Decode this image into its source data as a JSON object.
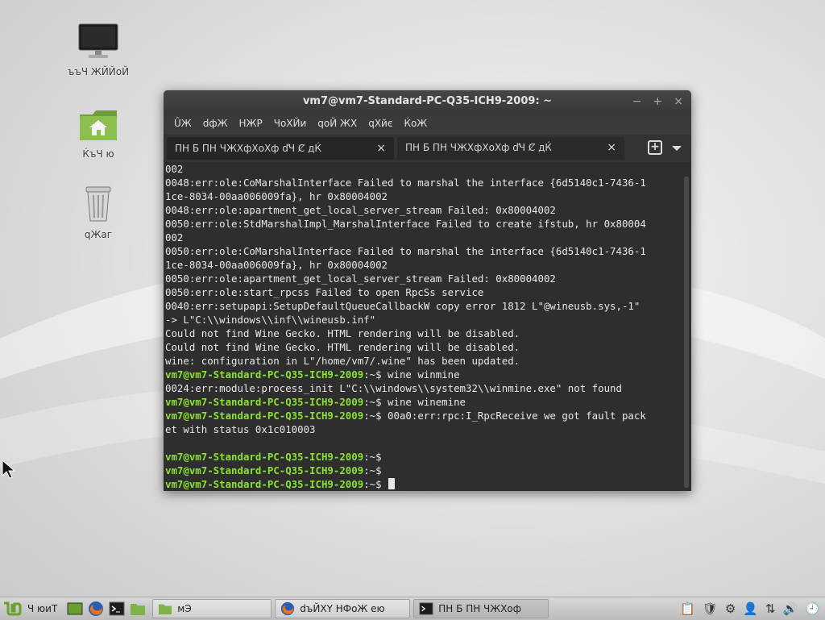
{
  "desktop": {
    "icons": [
      {
        "label": "ъъЧ ЖЙЙоЙ",
        "icon": "computer-icon"
      },
      {
        "label": "ЌъЧ ю",
        "icon": "home-folder-icon"
      },
      {
        "label": "qЖаг",
        "icon": "trash-icon"
      }
    ]
  },
  "window": {
    "title": "vm7@vm7-Standard-PC-Q35-ICH9-2009: ~",
    "controls": {
      "minimize": "−",
      "maximize": "+",
      "close": "×"
    },
    "menu": [
      "ÛЖ",
      "dфЖ",
      "НЖР",
      "ЧоХЙи",
      "qоЙ ЖХ",
      "qХйє",
      "ЌоЖ"
    ],
    "tabs": [
      {
        "label": "ПН  Б ПН   ЧЖХфХоХф ďЧ Ȼ    дЌ",
        "close": "×"
      },
      {
        "label": "ПН  Б ПН   ЧЖХфХоХф ďЧ Ȼ    дЌ",
        "close": "×"
      }
    ],
    "new_tab": "+"
  },
  "terminal": {
    "prompt_user": "vm7@vm7-Standard-PC-Q35-ICH9-2009",
    "lines": [
      {
        "type": "out",
        "text": "002"
      },
      {
        "type": "out",
        "text": "0048:err:ole:CoMarshalInterface Failed to marshal the interface {6d5140c1-7436-1"
      },
      {
        "type": "out",
        "text": "1ce-8034-00aa006009fa}, hr 0x80004002"
      },
      {
        "type": "out",
        "text": "0048:err:ole:apartment_get_local_server_stream Failed: 0x80004002"
      },
      {
        "type": "out",
        "text": "0050:err:ole:StdMarshalImpl_MarshalInterface Failed to create ifstub, hr 0x80004"
      },
      {
        "type": "out",
        "text": "002"
      },
      {
        "type": "out",
        "text": "0050:err:ole:CoMarshalInterface Failed to marshal the interface {6d5140c1-7436-1"
      },
      {
        "type": "out",
        "text": "1ce-8034-00aa006009fa}, hr 0x80004002"
      },
      {
        "type": "out",
        "text": "0050:err:ole:apartment_get_local_server_stream Failed: 0x80004002"
      },
      {
        "type": "out",
        "text": "0050:err:ole:start_rpcss Failed to open RpcSs service"
      },
      {
        "type": "out",
        "text": "0040:err:setupapi:SetupDefaultQueueCallbackW copy error 1812 L\"@wineusb.sys,-1\""
      },
      {
        "type": "out",
        "text": "-> L\"C:\\\\windows\\\\inf\\\\wineusb.inf\""
      },
      {
        "type": "out",
        "text": "Could not find Wine Gecko. HTML rendering will be disabled."
      },
      {
        "type": "out",
        "text": "Could not find Wine Gecko. HTML rendering will be disabled."
      },
      {
        "type": "out",
        "text": "wine: configuration in L\"/home/vm7/.wine\" has been updated."
      },
      {
        "type": "prompt",
        "path": ":~$",
        "text": " wine winmine"
      },
      {
        "type": "out",
        "text": "0024:err:module:process_init L\"C:\\\\windows\\\\system32\\\\winmine.exe\" not found"
      },
      {
        "type": "prompt",
        "path": ":~$",
        "text": " wine winemine"
      },
      {
        "type": "prompt",
        "path": ":~$",
        "text": " 00a0:err:rpc:I_RpcReceive we got fault pack"
      },
      {
        "type": "out",
        "text": "et with status 0x1c010003"
      },
      {
        "type": "out",
        "text": ""
      },
      {
        "type": "prompt",
        "path": ":~$",
        "text": ""
      },
      {
        "type": "prompt",
        "path": ":~$",
        "text": ""
      },
      {
        "type": "prompt",
        "path": ":~$",
        "text": ""
      }
    ]
  },
  "taskbar": {
    "menu_label": "Ч юиТ",
    "tasks": [
      {
        "label": "мЭ",
        "icon": "folder-icon"
      },
      {
        "label": "dъЙХY  НФоЖ ею",
        "icon": "firefox-icon"
      },
      {
        "label": "ПН  Б ПН   ЧЖХоф",
        "icon": "terminal-icon"
      }
    ]
  },
  "colors": {
    "prompt_green": "#8ae234",
    "terminal_bg": "#2e2e2e",
    "titlebar_bg": "#3c3c3c"
  }
}
